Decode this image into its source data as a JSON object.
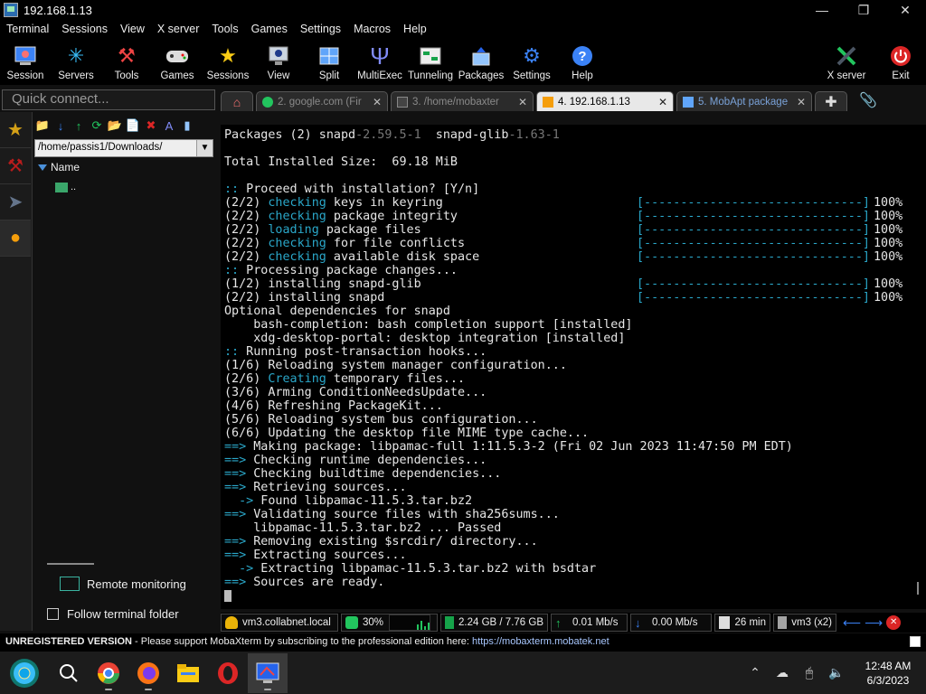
{
  "window": {
    "title": "192.168.1.13",
    "controls": [
      "minimize",
      "maximize",
      "close"
    ]
  },
  "menu": [
    "Terminal",
    "Sessions",
    "View",
    "X server",
    "Tools",
    "Games",
    "Settings",
    "Macros",
    "Help"
  ],
  "toolbar": [
    {
      "label": "Session",
      "icon": "session-icon"
    },
    {
      "label": "Servers",
      "icon": "servers-icon"
    },
    {
      "label": "Tools",
      "icon": "tools-icon"
    },
    {
      "label": "Games",
      "icon": "games-icon"
    },
    {
      "label": "Sessions",
      "icon": "sessions-star-icon"
    },
    {
      "label": "View",
      "icon": "view-icon"
    },
    {
      "label": "Split",
      "icon": "split-icon"
    },
    {
      "label": "MultiExec",
      "icon": "multiexec-icon"
    },
    {
      "label": "Tunneling",
      "icon": "tunneling-icon"
    },
    {
      "label": "Packages",
      "icon": "packages-icon"
    },
    {
      "label": "Settings",
      "icon": "settings-icon"
    },
    {
      "label": "Help",
      "icon": "help-icon"
    }
  ],
  "toolbar_right": [
    {
      "label": "X server",
      "icon": "xserver-icon"
    },
    {
      "label": "Exit",
      "icon": "exit-icon"
    }
  ],
  "quick_connect": {
    "placeholder": "Quick connect..."
  },
  "tabs": [
    {
      "label": "2. google.com (Fir",
      "icon": "globe-icon",
      "active": false
    },
    {
      "label": "3. /home/mobaxter",
      "icon": "terminal-icon",
      "active": false
    },
    {
      "label": "4. 192.168.1.13",
      "icon": "ssh-icon",
      "active": true
    },
    {
      "label": "5. MobApt package",
      "icon": "package-icon",
      "active": false
    }
  ],
  "sidebar": {
    "path": "/home/passis1/Downloads/",
    "tree_header": "Name",
    "tree_items": [
      ".."
    ],
    "remote_monitoring": "Remote monitoring",
    "follow_terminal": "Follow terminal folder"
  },
  "terminal": {
    "lines": [
      {
        "t": "Packages (2) snapd-2.59.5-1  snapd-glib-1.63-1"
      },
      {
        "t": ""
      },
      {
        "t": "Total Installed Size:  69.18 MiB"
      },
      {
        "t": ""
      },
      {
        "t": ":: Proceed with installation? [Y/n]"
      },
      {
        "t": "(2/2) checking keys in keyring",
        "bar": "[------------------------------]",
        "pct": "100%"
      },
      {
        "t": "(2/2) checking package integrity",
        "bar": "[------------------------------]",
        "pct": "100%"
      },
      {
        "t": "(2/2) loading package files",
        "bar": "[------------------------------]",
        "pct": "100%"
      },
      {
        "t": "(2/2) checking for file conflicts",
        "bar": "[------------------------------]",
        "pct": "100%"
      },
      {
        "t": "(2/2) checking available disk space",
        "bar": "[------------------------------]",
        "pct": "100%"
      },
      {
        "t": ":: Processing package changes..."
      },
      {
        "t": "(1/2) installing snapd-glib",
        "bar": "[------------------------------]",
        "pct": "100%"
      },
      {
        "t": "(2/2) installing snapd",
        "bar": "[------------------------------]",
        "pct": "100%"
      },
      {
        "t": "Optional dependencies for snapd"
      },
      {
        "t": "    bash-completion: bash completion support [installed]"
      },
      {
        "t": "    xdg-desktop-portal: desktop integration [installed]"
      },
      {
        "t": ":: Running post-transaction hooks..."
      },
      {
        "t": "(1/6) Reloading system manager configuration..."
      },
      {
        "t": "(2/6) Creating temporary files..."
      },
      {
        "t": "(3/6) Arming ConditionNeedsUpdate..."
      },
      {
        "t": "(4/6) Refreshing PackageKit..."
      },
      {
        "t": "(5/6) Reloading system bus configuration..."
      },
      {
        "t": "(6/6) Updating the desktop file MIME type cache..."
      },
      {
        "t": "==> Making package: libpamac-full 1:11.5.3-2 (Fri 02 Jun 2023 11:47:50 PM EDT)"
      },
      {
        "t": "==> Checking runtime dependencies..."
      },
      {
        "t": "==> Checking buildtime dependencies..."
      },
      {
        "t": "==> Retrieving sources..."
      },
      {
        "t": "  -> Found libpamac-11.5.3.tar.bz2"
      },
      {
        "t": "==> Validating source files with sha256sums..."
      },
      {
        "t": "    libpamac-11.5.3.tar.bz2 ... Passed"
      },
      {
        "t": "==> Removing existing $srcdir/ directory..."
      },
      {
        "t": "==> Extracting sources..."
      },
      {
        "t": "  -> Extracting libpamac-11.5.3.tar.bz2 with bsdtar"
      },
      {
        "t": "==> Sources are ready."
      }
    ]
  },
  "statusbar": {
    "host": "vm3.collabnet.local",
    "cpu": "30%",
    "memory": "2.24 GB / 7.76 GB",
    "upload": "0.01 Mb/s",
    "download": "0.00 Mb/s",
    "uptime": "26 min",
    "user": "vm3 (x2)"
  },
  "unregistered": {
    "bold": "UNREGISTERED VERSION",
    "text": " -  Please support MobaXterm by subscribing to the professional edition here: ",
    "link": "https://mobaxterm.mobatek.net"
  },
  "taskbar": {
    "apps": [
      "windows-start-icon",
      "search-icon",
      "chrome-icon",
      "firefox-icon",
      "file-explorer-icon",
      "opera-icon",
      "mobaxterm-icon"
    ],
    "time": "12:48 AM",
    "date": "6/3/2023"
  },
  "colors": {
    "accent_cyan": "#2aa7c9",
    "terminal_bg": "#000000",
    "terminal_fg": "#e6e6e6"
  }
}
